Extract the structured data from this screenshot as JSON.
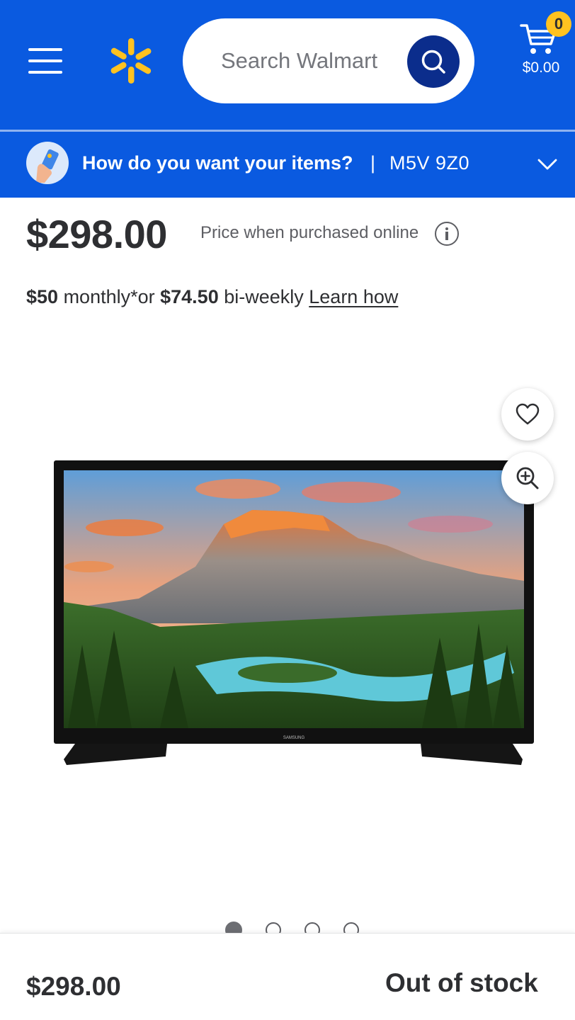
{
  "header": {
    "search": {
      "placeholder": "Search Walmart"
    },
    "cart": {
      "count": "0",
      "total": "$0.00"
    },
    "colors": {
      "brand_blue": "#0a5ae0",
      "spark_yellow": "#ffc220",
      "search_button": "#0b2d8c"
    }
  },
  "delivery": {
    "prompt": "How do you want your items?",
    "separator": "|",
    "postal_code": "M5V 9Z0"
  },
  "product": {
    "price": "$298.00",
    "price_note": "Price when purchased online",
    "financing": {
      "monthly_amount": "$50",
      "monthly_text": " monthly*or ",
      "biweekly_amount": "$74.50",
      "biweekly_text": " bi-weekly ",
      "learn_link": "Learn how"
    },
    "image": {
      "brand_label": "SAMSUNG",
      "carousel_count": 4,
      "carousel_active": 1
    }
  },
  "bottom_bar": {
    "price": "$298.00",
    "status": "Out of stock"
  },
  "icons": [
    "menu-icon",
    "walmart-spark-logo",
    "search-icon",
    "cart-icon",
    "delivery-hand-icon",
    "chevron-down-icon",
    "info-icon",
    "heart-icon",
    "zoom-in-icon"
  ]
}
